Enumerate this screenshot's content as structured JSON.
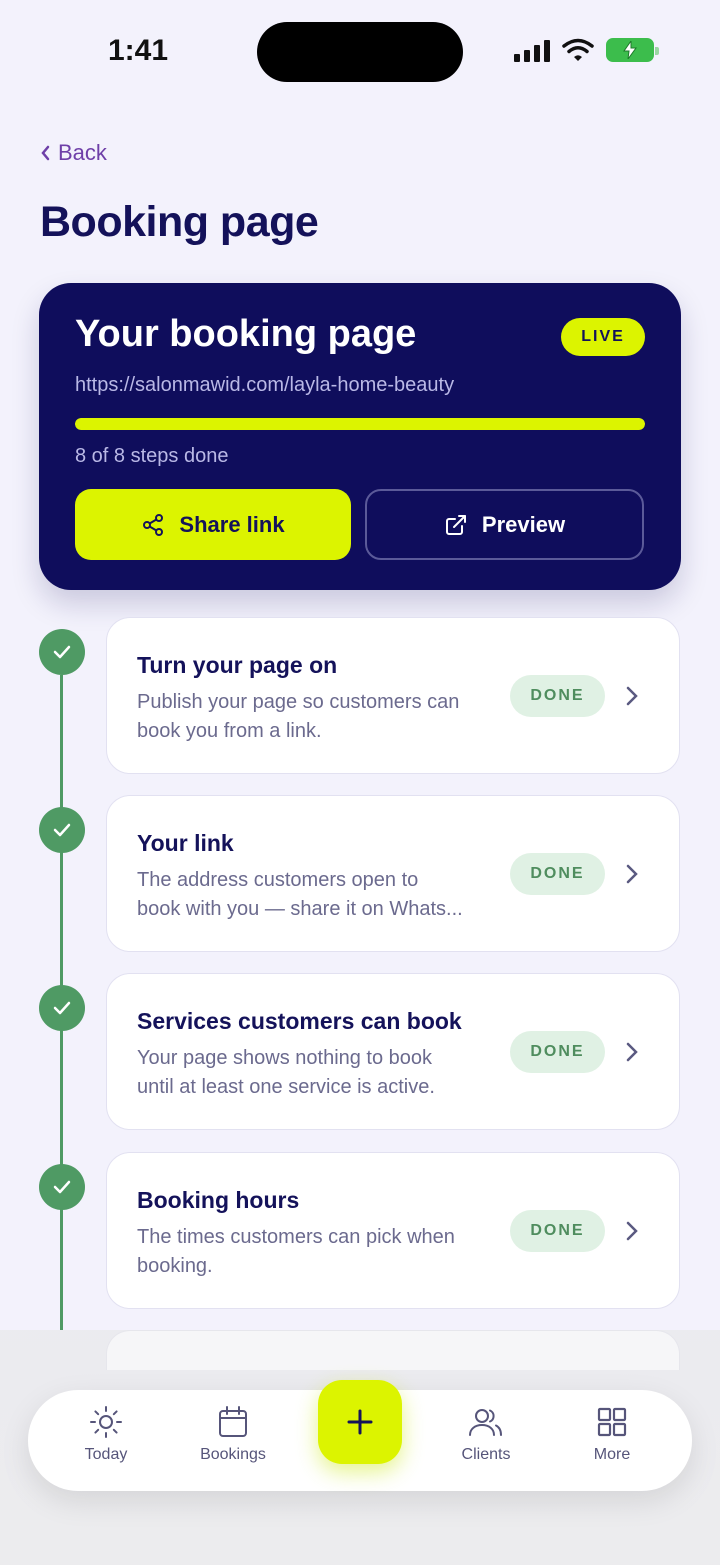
{
  "status_bar": {
    "time": "1:41"
  },
  "header": {
    "back_label": "Back",
    "title": "Booking page"
  },
  "hero": {
    "title": "Your booking page",
    "badge": "LIVE",
    "url": "https://salonmawid.com/layla-home-beauty",
    "progress_fraction": 1.0,
    "steps_text": "8 of 8 steps done",
    "share_label": "Share link",
    "preview_label": "Preview"
  },
  "steps": [
    {
      "title": "Turn your page on",
      "desc1": "Publish your page so customers can",
      "desc2": "book you from a link.",
      "badge": "DONE"
    },
    {
      "title": "Your link",
      "desc1": "The address customers open to",
      "desc2": "book with you — share it on Whats...",
      "badge": "DONE"
    },
    {
      "title": "Services customers can book",
      "desc1": "Your page shows nothing to book",
      "desc2": "until at least one service is active.",
      "badge": "DONE"
    },
    {
      "title": "Booking hours",
      "desc1": "The times customers can pick when",
      "desc2": "booking.",
      "badge": "DONE"
    }
  ],
  "nav": {
    "today": "Today",
    "bookings": "Bookings",
    "clients": "Clients",
    "more": "More"
  },
  "colors": {
    "navy": "#0f0d5c",
    "lime": "#dcf400",
    "green": "#4f9a64",
    "purple": "#6e3fa8"
  }
}
